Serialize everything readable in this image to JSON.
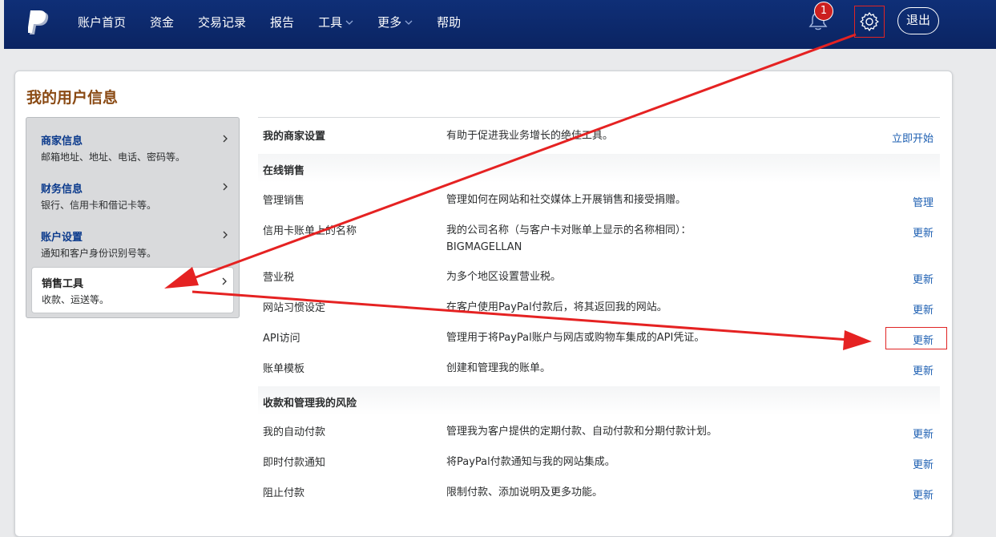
{
  "nav": {
    "items": [
      "账户首页",
      "资金",
      "交易记录",
      "报告",
      "工具",
      "更多",
      "帮助"
    ],
    "notification_count": "1",
    "logout_label": "退出"
  },
  "page": {
    "title": "我的用户信息"
  },
  "sidebar": {
    "items": [
      {
        "title": "商家信息",
        "subtitle": "邮箱地址、地址、电话、密码等。"
      },
      {
        "title": "财务信息",
        "subtitle": "银行、信用卡和借记卡等。"
      },
      {
        "title": "账户设置",
        "subtitle": "通知和客户身份识别号等。"
      },
      {
        "title": "销售工具",
        "subtitle": "收款、运送等。",
        "active": true
      }
    ]
  },
  "content": {
    "merchant_setting": {
      "label": "我的商家设置",
      "desc": "有助于促进我业务增长的绝佳工具。",
      "action": "立即开始"
    },
    "sections": [
      {
        "title": "在线销售",
        "rows": [
          {
            "label": "管理销售",
            "desc": "管理如何在网站和社交媒体上开展销售和接受捐赠。",
            "action": "管理"
          },
          {
            "label": "信用卡账单上的名称",
            "desc": "我的公司名称（与客户卡对账单上显示的名称相同）：",
            "desc2": "BIGMAGELLAN",
            "action": "更新"
          },
          {
            "label": "营业税",
            "desc": "为多个地区设置营业税。",
            "action": "更新"
          },
          {
            "label": "网站习惯设定",
            "desc": "在客户使用PayPal付款后，将其返回我的网站。",
            "action": "更新"
          },
          {
            "label": "API访问",
            "desc": "管理用于将PayPal账户与网店或购物车集成的API凭证。",
            "action": "更新"
          },
          {
            "label": "账单模板",
            "desc": "创建和管理我的账单。",
            "action": "更新"
          }
        ]
      },
      {
        "title": "收款和管理我的风险",
        "rows": [
          {
            "label": "我的自动付款",
            "desc": "管理我为客户提供的定期付款、自动付款和分期付款计划。",
            "action": "更新"
          },
          {
            "label": "即时付款通知",
            "desc": "将PayPal付款通知与我的网站集成。",
            "action": "更新"
          },
          {
            "label": "阻止付款",
            "desc": "限制付款、添加说明及更多功能。",
            "action": "更新"
          }
        ]
      }
    ]
  },
  "colors": {
    "nav_bg": "#0d2a6e",
    "link": "#1d5fb2",
    "annotation": "#e02424",
    "title": "#8a4a14"
  },
  "icons": [
    "paypal-logo-icon",
    "chevron-down-icon",
    "bell-icon",
    "gear-icon",
    "chevron-right-icon"
  ]
}
